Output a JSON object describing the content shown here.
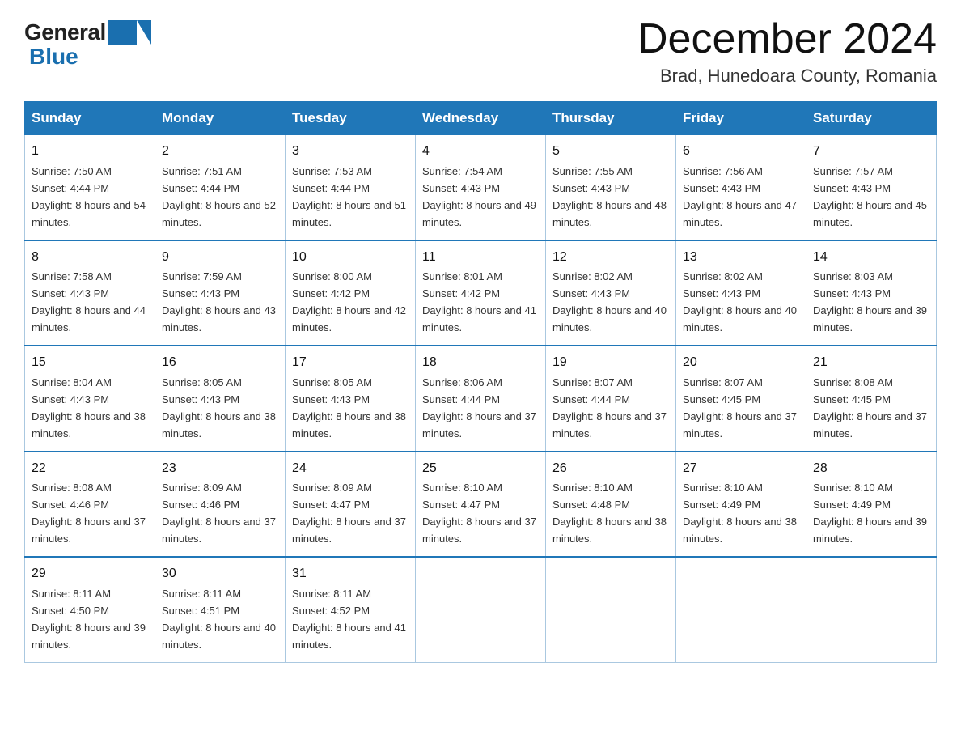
{
  "header": {
    "logo_general": "General",
    "logo_blue": "Blue",
    "title": "December 2024",
    "subtitle": "Brad, Hunedoara County, Romania"
  },
  "days_of_week": [
    "Sunday",
    "Monday",
    "Tuesday",
    "Wednesday",
    "Thursday",
    "Friday",
    "Saturday"
  ],
  "weeks": [
    [
      {
        "day": "1",
        "sunrise": "7:50 AM",
        "sunset": "4:44 PM",
        "daylight": "8 hours and 54 minutes."
      },
      {
        "day": "2",
        "sunrise": "7:51 AM",
        "sunset": "4:44 PM",
        "daylight": "8 hours and 52 minutes."
      },
      {
        "day": "3",
        "sunrise": "7:53 AM",
        "sunset": "4:44 PM",
        "daylight": "8 hours and 51 minutes."
      },
      {
        "day": "4",
        "sunrise": "7:54 AM",
        "sunset": "4:43 PM",
        "daylight": "8 hours and 49 minutes."
      },
      {
        "day": "5",
        "sunrise": "7:55 AM",
        "sunset": "4:43 PM",
        "daylight": "8 hours and 48 minutes."
      },
      {
        "day": "6",
        "sunrise": "7:56 AM",
        "sunset": "4:43 PM",
        "daylight": "8 hours and 47 minutes."
      },
      {
        "day": "7",
        "sunrise": "7:57 AM",
        "sunset": "4:43 PM",
        "daylight": "8 hours and 45 minutes."
      }
    ],
    [
      {
        "day": "8",
        "sunrise": "7:58 AM",
        "sunset": "4:43 PM",
        "daylight": "8 hours and 44 minutes."
      },
      {
        "day": "9",
        "sunrise": "7:59 AM",
        "sunset": "4:43 PM",
        "daylight": "8 hours and 43 minutes."
      },
      {
        "day": "10",
        "sunrise": "8:00 AM",
        "sunset": "4:42 PM",
        "daylight": "8 hours and 42 minutes."
      },
      {
        "day": "11",
        "sunrise": "8:01 AM",
        "sunset": "4:42 PM",
        "daylight": "8 hours and 41 minutes."
      },
      {
        "day": "12",
        "sunrise": "8:02 AM",
        "sunset": "4:43 PM",
        "daylight": "8 hours and 40 minutes."
      },
      {
        "day": "13",
        "sunrise": "8:02 AM",
        "sunset": "4:43 PM",
        "daylight": "8 hours and 40 minutes."
      },
      {
        "day": "14",
        "sunrise": "8:03 AM",
        "sunset": "4:43 PM",
        "daylight": "8 hours and 39 minutes."
      }
    ],
    [
      {
        "day": "15",
        "sunrise": "8:04 AM",
        "sunset": "4:43 PM",
        "daylight": "8 hours and 38 minutes."
      },
      {
        "day": "16",
        "sunrise": "8:05 AM",
        "sunset": "4:43 PM",
        "daylight": "8 hours and 38 minutes."
      },
      {
        "day": "17",
        "sunrise": "8:05 AM",
        "sunset": "4:43 PM",
        "daylight": "8 hours and 38 minutes."
      },
      {
        "day": "18",
        "sunrise": "8:06 AM",
        "sunset": "4:44 PM",
        "daylight": "8 hours and 37 minutes."
      },
      {
        "day": "19",
        "sunrise": "8:07 AM",
        "sunset": "4:44 PM",
        "daylight": "8 hours and 37 minutes."
      },
      {
        "day": "20",
        "sunrise": "8:07 AM",
        "sunset": "4:45 PM",
        "daylight": "8 hours and 37 minutes."
      },
      {
        "day": "21",
        "sunrise": "8:08 AM",
        "sunset": "4:45 PM",
        "daylight": "8 hours and 37 minutes."
      }
    ],
    [
      {
        "day": "22",
        "sunrise": "8:08 AM",
        "sunset": "4:46 PM",
        "daylight": "8 hours and 37 minutes."
      },
      {
        "day": "23",
        "sunrise": "8:09 AM",
        "sunset": "4:46 PM",
        "daylight": "8 hours and 37 minutes."
      },
      {
        "day": "24",
        "sunrise": "8:09 AM",
        "sunset": "4:47 PM",
        "daylight": "8 hours and 37 minutes."
      },
      {
        "day": "25",
        "sunrise": "8:10 AM",
        "sunset": "4:47 PM",
        "daylight": "8 hours and 37 minutes."
      },
      {
        "day": "26",
        "sunrise": "8:10 AM",
        "sunset": "4:48 PM",
        "daylight": "8 hours and 38 minutes."
      },
      {
        "day": "27",
        "sunrise": "8:10 AM",
        "sunset": "4:49 PM",
        "daylight": "8 hours and 38 minutes."
      },
      {
        "day": "28",
        "sunrise": "8:10 AM",
        "sunset": "4:49 PM",
        "daylight": "8 hours and 39 minutes."
      }
    ],
    [
      {
        "day": "29",
        "sunrise": "8:11 AM",
        "sunset": "4:50 PM",
        "daylight": "8 hours and 39 minutes."
      },
      {
        "day": "30",
        "sunrise": "8:11 AM",
        "sunset": "4:51 PM",
        "daylight": "8 hours and 40 minutes."
      },
      {
        "day": "31",
        "sunrise": "8:11 AM",
        "sunset": "4:52 PM",
        "daylight": "8 hours and 41 minutes."
      },
      null,
      null,
      null,
      null
    ]
  ]
}
